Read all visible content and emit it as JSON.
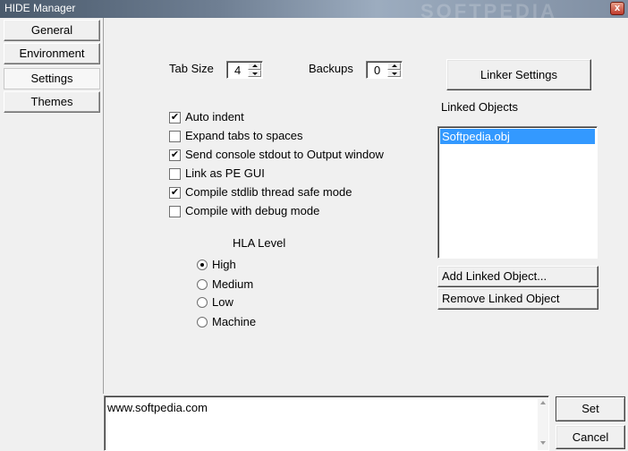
{
  "window": {
    "title": "HIDE Manager",
    "watermark": "SOFTPEDIA",
    "close_glyph": "x"
  },
  "tabs": [
    {
      "label": "General"
    },
    {
      "label": "Environment"
    },
    {
      "label": "Settings",
      "active": true
    },
    {
      "label": "Themes"
    }
  ],
  "settings": {
    "tab_size_label": "Tab Size",
    "tab_size_value": "4",
    "backups_label": "Backups",
    "backups_value": "0",
    "options": [
      {
        "label": "Auto indent",
        "checked": true
      },
      {
        "label": "Expand tabs to spaces",
        "checked": false
      },
      {
        "label": "Send console stdout to Output window",
        "checked": true
      },
      {
        "label": "Link as PE GUI",
        "checked": false
      },
      {
        "label": "Compile stdlib thread safe mode",
        "checked": true
      },
      {
        "label": "Compile with debug mode",
        "checked": false
      }
    ],
    "check_glyph": "✔",
    "hla_level": {
      "label": "HLA Level",
      "options": [
        {
          "label": "High",
          "selected": true
        },
        {
          "label": "Medium",
          "selected": false
        },
        {
          "label": "Low",
          "selected": false
        },
        {
          "label": "Machine",
          "selected": false
        }
      ]
    }
  },
  "linker": {
    "settings_button": "Linker Settings",
    "linked_objects_label": "Linked Objects",
    "items": [
      "Softpedia.obj"
    ],
    "add_button": "Add Linked Object...",
    "remove_button": "Remove Linked Object"
  },
  "memo": {
    "text": "www.softpedia.com"
  },
  "actions": {
    "set": "Set",
    "cancel": "Cancel"
  },
  "colors": {
    "selection": "#3399ff",
    "face": "#f0f0f0"
  }
}
